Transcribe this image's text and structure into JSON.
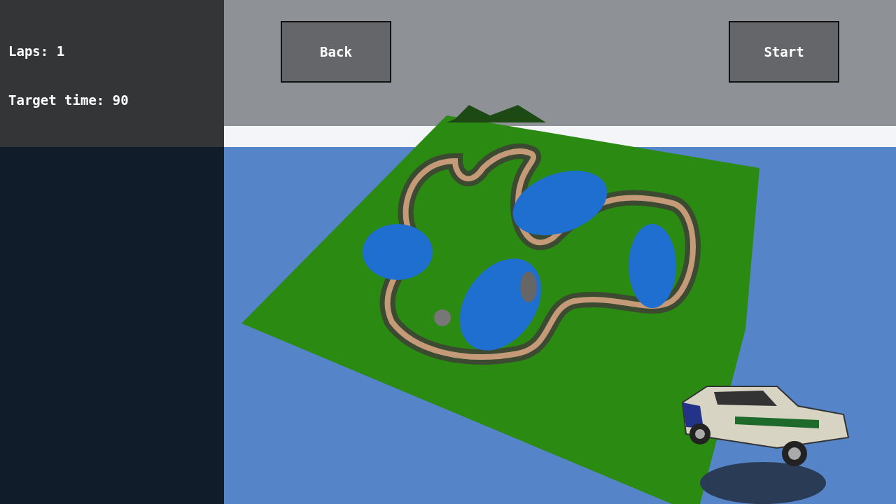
{
  "hud": {
    "stats": [
      "Laps: 1",
      "Target time: 90"
    ]
  },
  "buttons": [
    {
      "label": "Back"
    },
    {
      "label": "Start"
    }
  ]
}
